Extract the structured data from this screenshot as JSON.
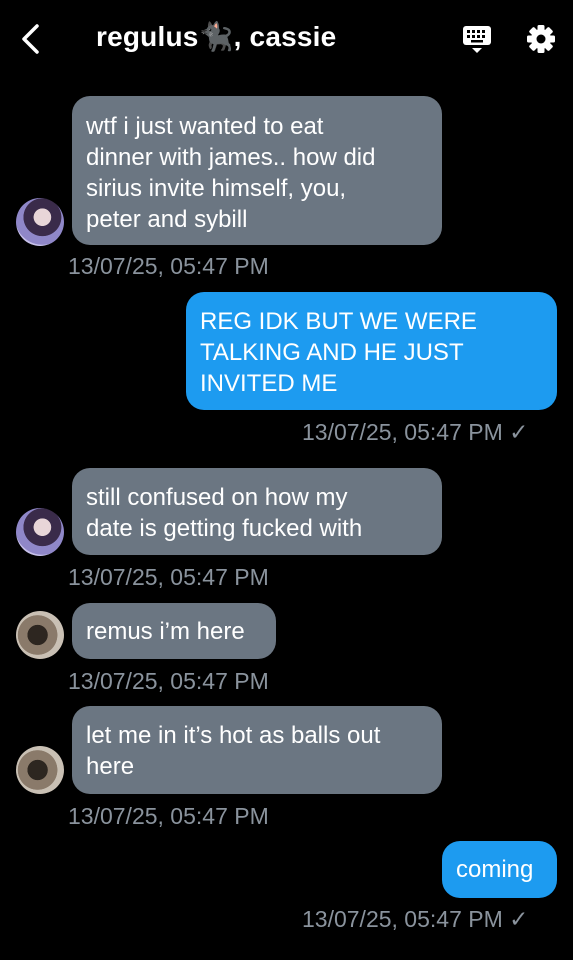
{
  "header": {
    "title": "regulus🐈‍⬛, cassie",
    "back_icon": "chevron-left-icon",
    "keyboard_icon": "keyboard-icon",
    "settings_icon": "gear-icon"
  },
  "messages": [
    {
      "direction": "incoming",
      "text": "wtf i just wanted to eat\ndinner with james.. how did\nsirius invite himself, you,\npeter and sybill",
      "timestamp": "13/07/25, 05:47 PM"
    },
    {
      "direction": "outgoing",
      "text": "REG IDK BUT WE WERE\nTALKING AND HE JUST\nINVITED ME",
      "timestamp": "13/07/25, 05:47 PM ✓"
    },
    {
      "direction": "incoming",
      "text": "still confused on how my\ndate is getting fucked with",
      "timestamp": "13/07/25, 05:47 PM"
    },
    {
      "direction": "incoming",
      "text": "remus i’m here",
      "timestamp": "13/07/25, 05:47 PM"
    },
    {
      "direction": "incoming",
      "text": "let me in it’s hot as balls out\nhere",
      "timestamp": "13/07/25, 05:47 PM"
    },
    {
      "direction": "outgoing",
      "text": "coming",
      "timestamp": "13/07/25, 05:47 PM ✓"
    }
  ]
}
